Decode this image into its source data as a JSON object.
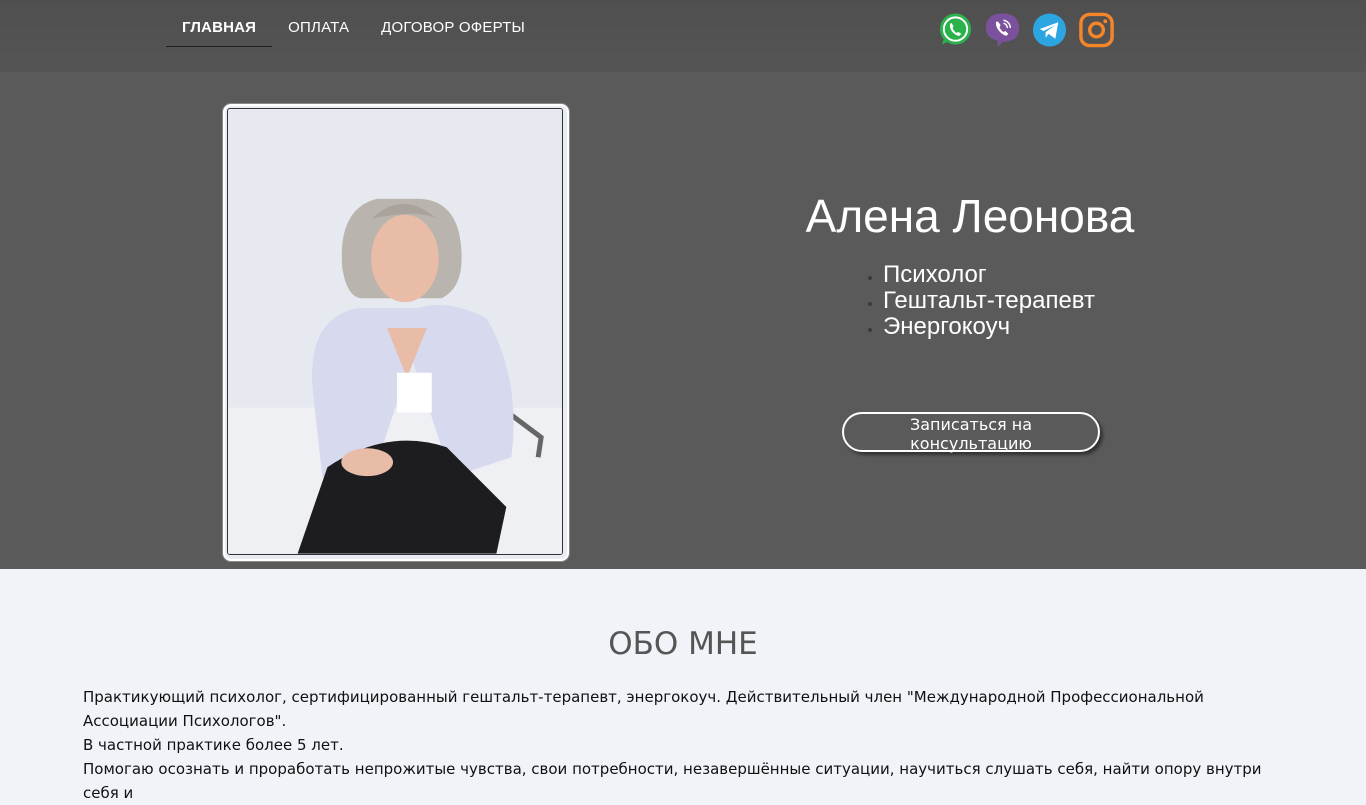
{
  "nav": {
    "items": [
      {
        "label": "ГЛАВНАЯ",
        "active": true
      },
      {
        "label": "ОПЛАТА",
        "active": false
      },
      {
        "label": "ДОГОВОР ОФЕРТЫ",
        "active": false
      }
    ]
  },
  "socials": [
    {
      "icon": "whatsapp-icon",
      "color": "#2bb24c"
    },
    {
      "icon": "viber-icon",
      "color": "#7b519d"
    },
    {
      "icon": "telegram-icon",
      "color": "#2ca5e0"
    },
    {
      "icon": "instagram-icon",
      "color": "#f58529"
    }
  ],
  "hero": {
    "name": "Алена Леонова",
    "roles": [
      "Психолог",
      "Гештальт-терапевт",
      "Энергокоуч"
    ],
    "cta_label": "Записаться на консультацию",
    "bg_color": "#5a5a5a"
  },
  "about": {
    "title": "ОБО МНЕ",
    "paragraphs": [
      "Практикующий психолог, сертифицированный гештальт-терапевт, энергокоуч. Действительный член \"Международной Профессиональной Ассоциации Психологов\".",
      "В частной практике более 5 лет.",
      "Помогаю осознать и проработать непрожитые чувства, свои потребности, незавершённые ситуации, научиться слушать себя, найти опору внутри себя и"
    ]
  }
}
